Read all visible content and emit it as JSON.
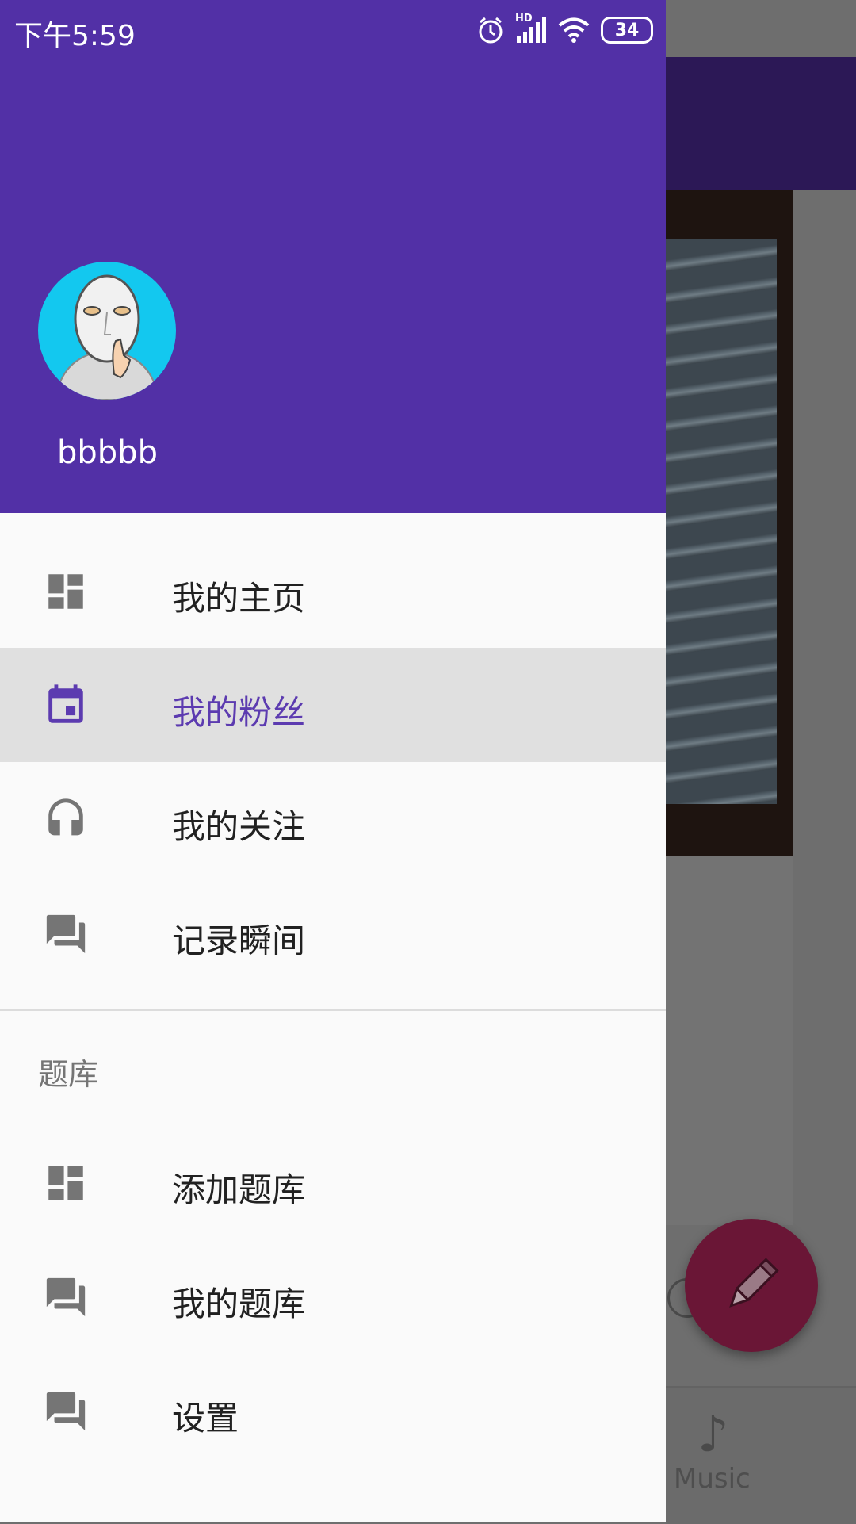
{
  "status_bar": {
    "time": "下午5:59",
    "network": "HD",
    "battery": "34"
  },
  "drawer": {
    "username": "bbbbb",
    "menu": [
      {
        "label": "我的主页",
        "icon": "dashboard-icon",
        "active": false
      },
      {
        "label": "我的粉丝",
        "icon": "calendar-icon",
        "active": true
      },
      {
        "label": "我的关注",
        "icon": "headset-icon",
        "active": false
      },
      {
        "label": "记录瞬间",
        "icon": "forum-icon",
        "active": false
      }
    ],
    "section_title": "题库",
    "section_menu": [
      {
        "label": "添加题库",
        "icon": "dashboard-icon"
      },
      {
        "label": "我的题库",
        "icon": "forum-icon"
      },
      {
        "label": "设置",
        "icon": "forum-icon"
      }
    ]
  },
  "background_app": {
    "bottom_nav_label": "Music",
    "bottom_nav_icon": "music-note-icon",
    "fab_icon": "pencil-icon"
  },
  "colors": {
    "primary": "#5230a6",
    "active_text": "#5c3bb0",
    "active_bg": "#e0e0e0",
    "fab": "#6a1636"
  }
}
